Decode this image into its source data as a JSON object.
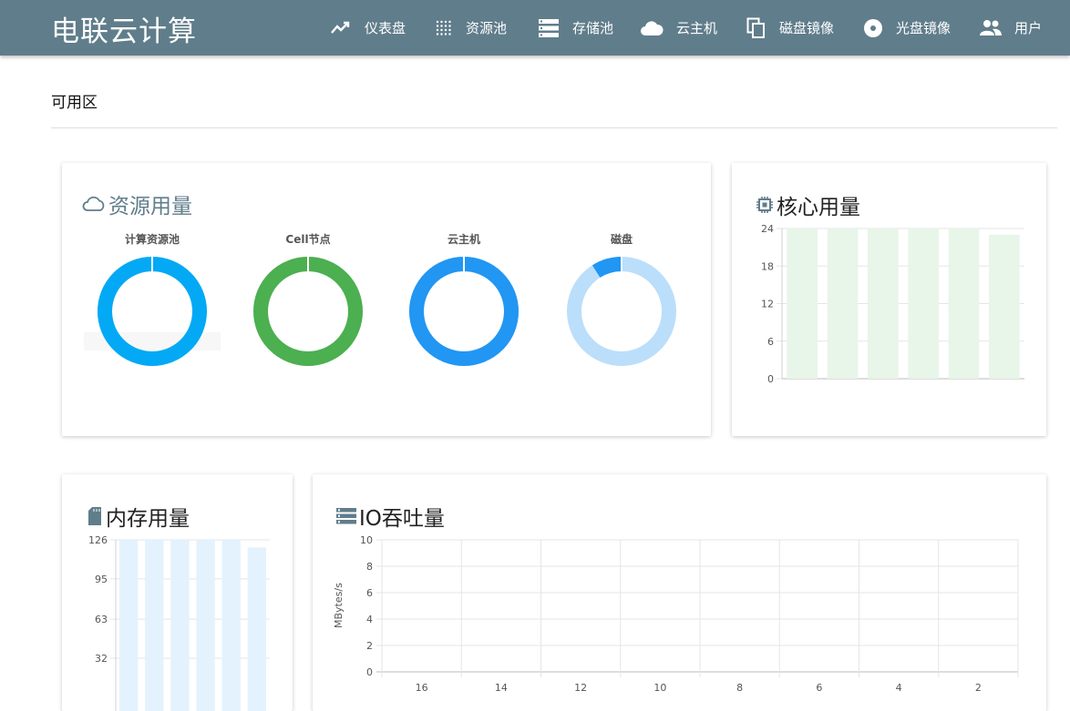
{
  "app": {
    "title": "电联云计算"
  },
  "nav": [
    {
      "label": "仪表盘",
      "icon": "trending-icon"
    },
    {
      "label": "资源池",
      "icon": "grid-dots-icon"
    },
    {
      "label": "存储池",
      "icon": "storage-icon"
    },
    {
      "label": "云主机",
      "icon": "cloud-icon"
    },
    {
      "label": "磁盘镜像",
      "icon": "copy-icon"
    },
    {
      "label": "光盘镜像",
      "icon": "disc-icon"
    },
    {
      "label": "用户",
      "icon": "users-icon"
    }
  ],
  "zone": {
    "label": "可用区"
  },
  "resource_card": {
    "title": "资源用量",
    "donuts": [
      {
        "label": "计算资源池",
        "used_fraction": 1.0,
        "color": "#03a9f4",
        "track": "#b3e5fc"
      },
      {
        "label": "Cell节点",
        "used_fraction": 1.0,
        "color": "#4caf50",
        "track": "#c8e6c9"
      },
      {
        "label": "云主机",
        "used_fraction": 1.0,
        "color": "#2196f3",
        "track": "#bbdefb"
      },
      {
        "label": "磁盘",
        "used_fraction": 0.09,
        "color": "#2196f3",
        "track": "#bbdefb"
      }
    ]
  },
  "core_card": {
    "title": "核心用量"
  },
  "memory_card": {
    "title": "内存用量"
  },
  "io_card": {
    "title": "IO吞吐量"
  },
  "chart_data": [
    {
      "type": "bar",
      "title": "核心用量",
      "values": [
        24,
        24,
        24,
        24,
        24,
        23
      ],
      "yticks": [
        0,
        6,
        12,
        18,
        24
      ],
      "ylim": [
        0,
        24
      ],
      "color": "#e8f5e9",
      "grid": true
    },
    {
      "type": "bar",
      "title": "内存用量",
      "values": [
        126,
        126,
        126,
        126,
        126,
        120
      ],
      "yticks": [
        32,
        63,
        95,
        126
      ],
      "ylim": [
        0,
        126
      ],
      "color": "#e3f2fd",
      "grid": true
    },
    {
      "type": "line",
      "title": "IO吞吐量",
      "ylabel": "MBytes/s",
      "xticks": [
        16,
        14,
        12,
        10,
        8,
        6,
        4,
        2
      ],
      "yticks": [
        0,
        2,
        4,
        6,
        8,
        10
      ],
      "ylim": [
        0,
        10
      ],
      "series": [],
      "grid": true
    }
  ]
}
